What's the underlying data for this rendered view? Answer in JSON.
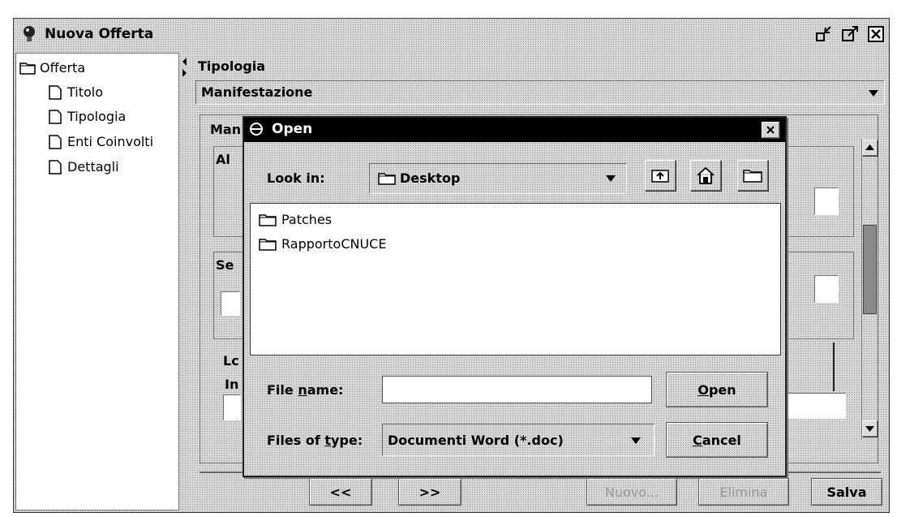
{
  "main_window": {
    "title": "Nuova Offerta",
    "controls": [
      "minimize-icon",
      "maximize-icon",
      "close-icon"
    ]
  },
  "tree": {
    "root": "Offerta",
    "items": [
      {
        "label": "Titolo"
      },
      {
        "label": "Tipologia"
      },
      {
        "label": "Enti Coinvolti"
      },
      {
        "label": "Dettagli"
      }
    ]
  },
  "form": {
    "tipologia_label": "Tipologia",
    "tipologia_value": "Manifestazione",
    "section_title": "Man",
    "groups": [
      "Al",
      "Se",
      "Lc"
    ],
    "field_prefix": "In"
  },
  "bottom_bar": {
    "prev_label": "<<",
    "next_label": ">>",
    "nuovo_label": "Nuovo...",
    "elimina_label": "Elimina",
    "salva_label": "Salva"
  },
  "open_dialog": {
    "title": "Open",
    "look_in_label": "Look in:",
    "look_in_value": "Desktop",
    "files": [
      {
        "name": "Patches"
      },
      {
        "name": "RapportoCNUCE"
      }
    ],
    "file_name_label_pre": "File ",
    "file_name_label_ul": "n",
    "file_name_label_post": "ame:",
    "file_name_value": "",
    "files_of_type_label_pre": "Files of ",
    "files_of_type_label_ul": "t",
    "files_of_type_label_post": "ype:",
    "files_of_type_value": "Documenti Word (*.doc)",
    "open_ul": "O",
    "open_rest": "pen",
    "cancel_ul": "C",
    "cancel_rest": "ancel",
    "toolbar_icons": [
      "up-folder-icon",
      "home-icon",
      "new-folder-icon"
    ]
  }
}
